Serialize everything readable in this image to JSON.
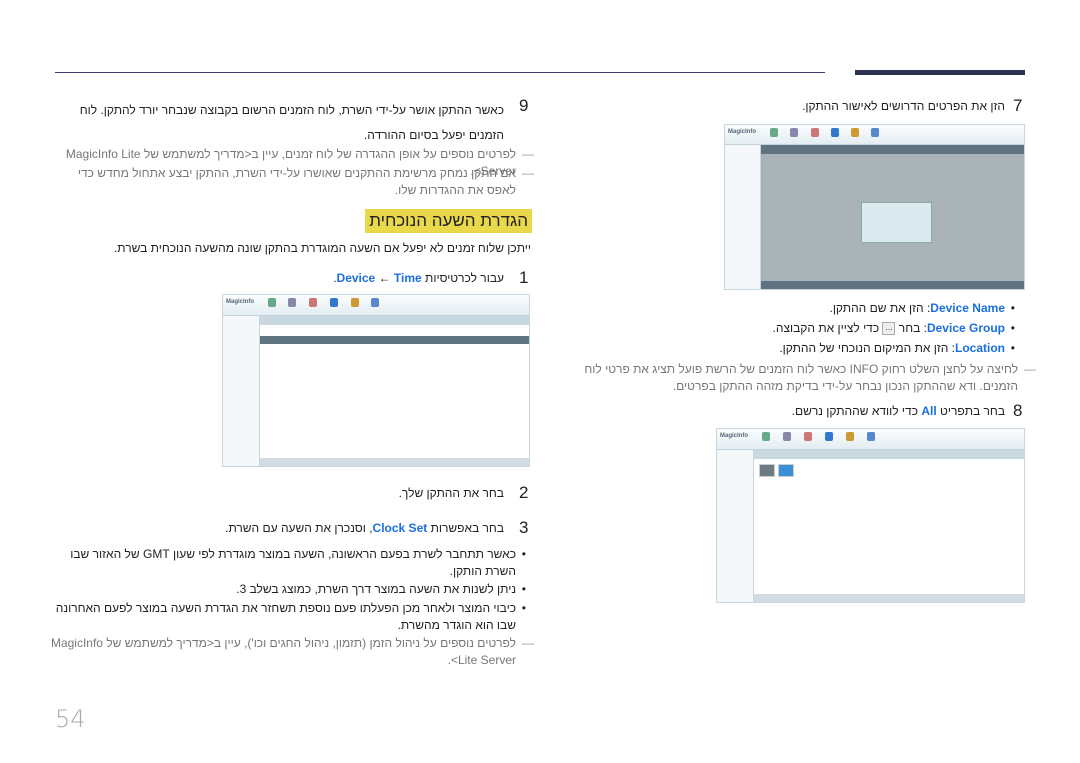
{
  "page_number": "54",
  "right": {
    "step7": {
      "num": "7",
      "text": "הזן את הפרטים הדרושים לאישור ההתקן."
    },
    "bullets": [
      {
        "label": "Device Name",
        "text": ": הזן את שם ההתקן."
      },
      {
        "label": "Device Group",
        "text": ": בחר ",
        "text2": " כדי לציין את הקבוצה."
      },
      {
        "label": "Location",
        "text": ": הזן את המיקום הנוכחי של ההתקן."
      }
    ],
    "note": "לחיצה על לחצן השלט רחוק INFO כאשר לוח הזמנים של הרשת פועל תציג את פרטי לוח הזמנים. ודא שההתקן הנכון נבחר על-ידי בדיקת מזהה ההתקן בפרטים.",
    "step8": {
      "num": "8",
      "pre": "בחר בתפריט ",
      "label": "All",
      "post": " כדי לוודא שההתקן נרשם."
    }
  },
  "left": {
    "step9": {
      "num": "9",
      "text": "כאשר ההתקן אושר על-ידי השרת, לוח הזמנים הרשום בקבוצה שנבחר יורד להתקן. לוח הזמנים יפעל בסיום ההורדה."
    },
    "notes": [
      "לפרטים נוספים על אופן ההגדרה של לוח זמנים, עיין ב<מדריך למשתמש של MagicInfo Lite Server>.",
      "אם התקן נמחק מרשימת ההתקנים שאושרו על-ידי השרת, ההתקן יבצע אתחול מחדש כדי לאפס את ההגדרות שלו."
    ],
    "heading": "הגדרת השעה הנוכחית",
    "intro": "ייתכן שלוח זמנים לא יפעל אם השעה המוגדרת בהתקן שונה מהשעה הנוכחית בשרת.",
    "step1": {
      "num": "1",
      "pre": "עבור לכרטיסיות ",
      "a": "Device",
      "arrow": " ← ",
      "b": "Time",
      "post": "."
    },
    "step2": {
      "num": "2",
      "text": "בחר את ההתקן שלך."
    },
    "step3": {
      "num": "3",
      "pre": "בחר באפשרות ",
      "label": "Clock Set",
      "post": ", וסנכרן את השעה עם השרת."
    },
    "bullets": [
      "כאשר תתחבר לשרת בפעם הראשונה, השעה במוצר מוגדרת לפי שעון GMT של האזור שבו השרת הותקן.",
      "ניתן לשנות את השעה במוצר דרך השרת, כמוצג בשלב 3.",
      "כיבוי המוצר ולאחר מכן הפעלתו פעם נוספת תשחזר את הגדרת השעה במוצר לפעם האחרונה שבו הוא הוגדר מהשרת."
    ],
    "note2": "לפרטים נוספים על ניהול הזמן (תזמון, ניהול החגים וכו'), עיין ב<מדריך למשתמש של MagicInfo Lite Server>."
  },
  "screenshot_logo": "MagicInfo",
  "colors": {
    "accent": "#1a6fe0",
    "heading_bg": "#e9d84a",
    "rule": "#2d3152"
  }
}
